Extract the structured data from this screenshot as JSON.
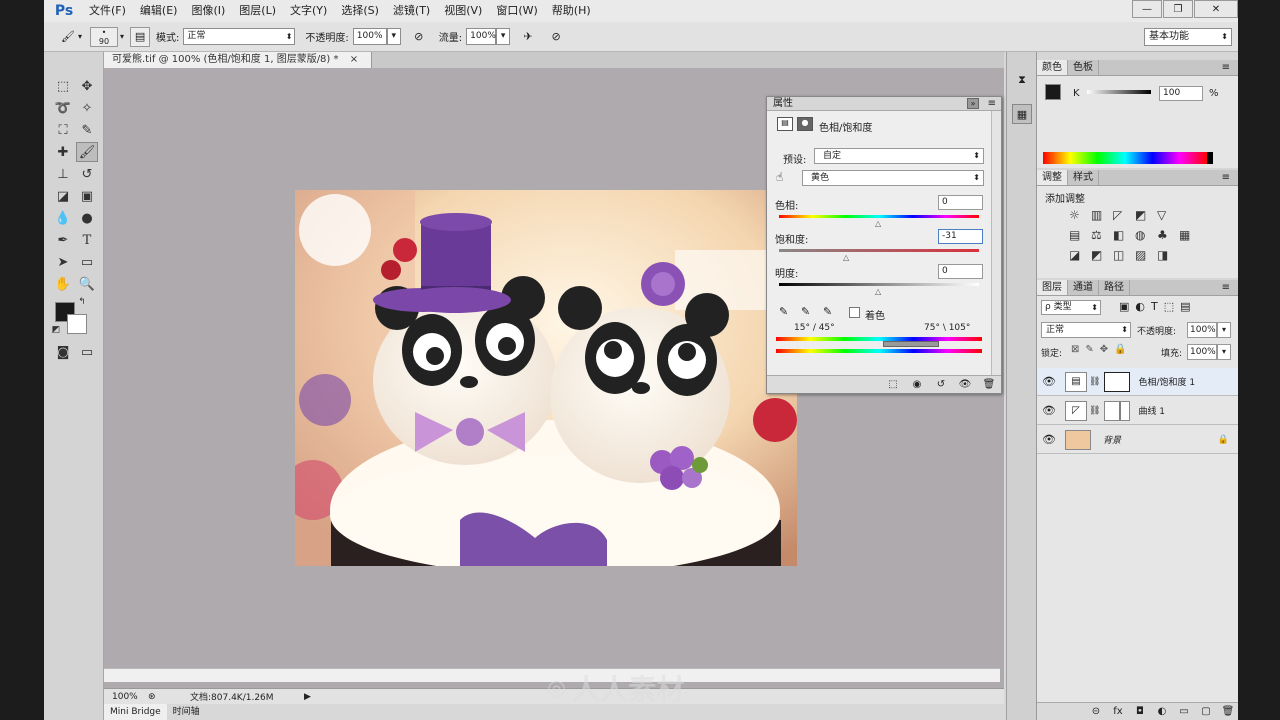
{
  "app": {
    "logo": "Ps"
  },
  "menu": [
    "文件(F)",
    "编辑(E)",
    "图像(I)",
    "图层(L)",
    "文字(Y)",
    "选择(S)",
    "滤镜(T)",
    "视图(V)",
    "窗口(W)",
    "帮助(H)"
  ],
  "window_buttons": [
    "—",
    "❐",
    "✕"
  ],
  "options": {
    "brush_size": "90",
    "mode_label": "模式:",
    "mode_value": "正常",
    "opacity_label": "不透明度:",
    "opacity_value": "100%",
    "flow_label": "流量:",
    "flow_value": "100%",
    "workspace": "基本功能"
  },
  "document": {
    "tab_title": "可爱熊.tif @ 100% (色相/饱和度 1, 图层蒙版/8) *",
    "close": "×",
    "zoom": "100%",
    "doc_size": "文档:807.4K/1.26M",
    "bottom_tabs": [
      "Mini Bridge",
      "时间轴"
    ]
  },
  "properties": {
    "title": "属性",
    "adjustment_name": "色相/饱和度",
    "preset_label": "预设:",
    "preset_value": "自定",
    "channel_value": "黄色",
    "hue_label": "色相:",
    "hue_value": "0",
    "saturation_label": "饱和度:",
    "saturation_value": "-31",
    "lightness_label": "明度:",
    "lightness_value": "0",
    "colorize_label": "着色",
    "range_left": "15° / 45°",
    "range_right": "75° \\ 105°"
  },
  "color_panel": {
    "tabs": [
      "颜色",
      "色板"
    ],
    "channel_label": "K",
    "value": "100",
    "unit": "%"
  },
  "adjust_panel": {
    "tabs": [
      "调整",
      "样式"
    ],
    "heading": "添加调整"
  },
  "layers_panel": {
    "tabs": [
      "图层",
      "通道",
      "路径"
    ],
    "filter_label": "ρ 类型",
    "blend_mode": "正常",
    "opacity_label": "不透明度:",
    "opacity_value": "100%",
    "lock_label": "锁定:",
    "fill_label": "填充:",
    "fill_value": "100%",
    "layers": [
      {
        "name": "色相/饱和度 1"
      },
      {
        "name": "曲线 1"
      },
      {
        "name": "背景"
      }
    ],
    "footer_icons": [
      "⊝",
      "fx",
      "◘",
      "◐",
      "▭",
      "▢",
      "🗑"
    ]
  },
  "watermark": "人人素材",
  "colors": {
    "accent": "#1e62b8",
    "canvas_bg": "#aeaaae"
  }
}
